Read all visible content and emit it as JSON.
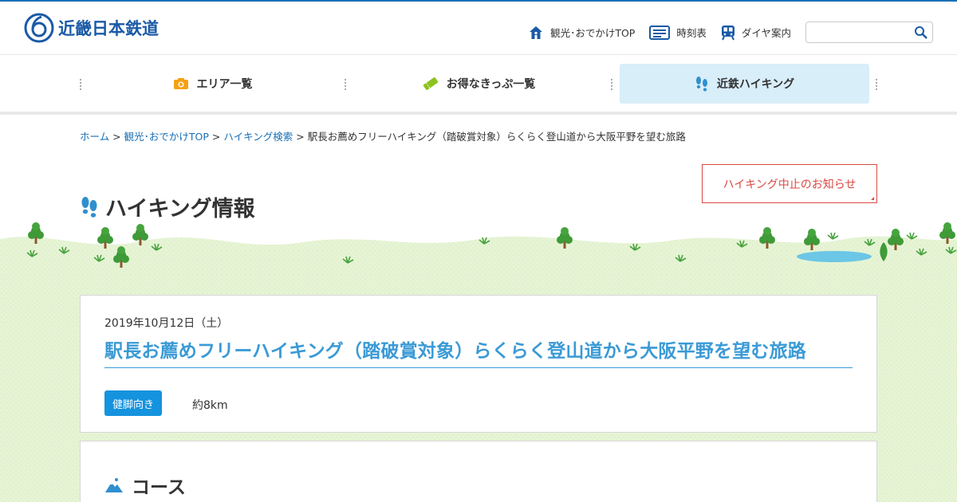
{
  "header": {
    "logo_text": "近畿日本鉄道",
    "utility": [
      {
        "label": "観光･おでかけTOP",
        "icon": "house-icon"
      },
      {
        "label": "時刻表",
        "icon": "timetable-icon"
      },
      {
        "label": "ダイヤ案内",
        "icon": "train-icon"
      }
    ],
    "search": {
      "placeholder": "",
      "value": ""
    }
  },
  "nav": {
    "items": [
      {
        "label": "エリア一覧",
        "icon": "camera-icon",
        "color": "#f4a114"
      },
      {
        "label": "お得なきっぷ一覧",
        "icon": "ticket-icon",
        "color": "#8dc21f"
      },
      {
        "label": "近鉄ハイキング",
        "icon": "footprint-icon",
        "color": "#2f8fce",
        "active": true
      }
    ]
  },
  "breadcrumb": {
    "items": [
      "ホーム",
      "観光･おでかけTOP",
      "ハイキング検索"
    ],
    "separator": ">",
    "current": "駅長お薦めフリーハイキング（踏破賞対象）らくらく登山道から大阪平野を望む旅路"
  },
  "notice": {
    "label": "ハイキング中止のお知らせ"
  },
  "page_title": "ハイキング情報",
  "event": {
    "date": "2019年10月12日（土）",
    "title": "駅長お薦めフリーハイキング（踏破賞対象）らくらく登山道から大阪平野を望む旅路",
    "level": "健脚向き",
    "distance": "約8km"
  },
  "course": {
    "heading": "コース"
  },
  "colors": {
    "brand": "#1a5aa6",
    "link": "#1a6fb5",
    "title": "#3a9ad6",
    "badge": "#1593df",
    "notice": "#d94a45",
    "nav_active_bg": "#d8eef9",
    "grass": "#e6f4d5"
  }
}
